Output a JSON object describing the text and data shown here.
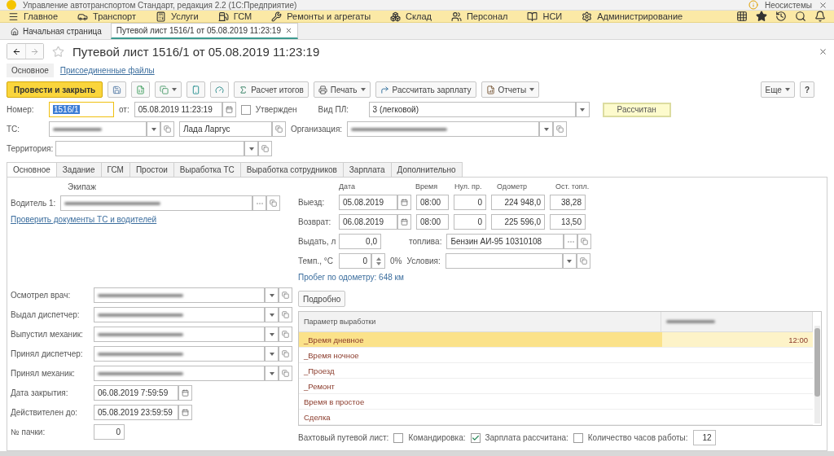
{
  "window": {
    "title": "Управление автотранспортом Стандарт, редакция 2.2  (1С:Предприятие)",
    "user": "Неосистемы"
  },
  "sections": [
    {
      "label": "Главное",
      "kind": "menu"
    },
    {
      "label": "Транспорт",
      "kind": "car"
    },
    {
      "label": "Услуги",
      "kind": "calc"
    },
    {
      "label": "ГСМ",
      "kind": "fuel"
    },
    {
      "label": "Ремонты и агрегаты",
      "kind": "wrench"
    },
    {
      "label": "Склад",
      "kind": "boxes"
    },
    {
      "label": "Персонал",
      "kind": "person"
    },
    {
      "label": "НСИ",
      "kind": "book"
    },
    {
      "label": "Администрирование",
      "kind": "gear"
    }
  ],
  "open_tabs": [
    {
      "label": "Начальная страница",
      "kind": "home",
      "selected": false
    },
    {
      "label": "Путевой лист 1516/1 от 05.08.2019 11:23:19",
      "kind": "doc",
      "selected": true
    }
  ],
  "document": {
    "title": "Путевой лист 1516/1 от 05.08.2019 11:23:19",
    "views": [
      {
        "label": "Основное",
        "selected": true
      },
      {
        "label": "Присоединенные файлы",
        "selected": false
      }
    ]
  },
  "toolbar": {
    "primary": "Провести и закрыть",
    "buttons": [
      {
        "kind": "save"
      },
      {
        "kind": "sheet"
      },
      {
        "kind": "copy",
        "menu": true
      },
      {
        "kind": "phone"
      },
      {
        "kind": "gauge"
      },
      {
        "kind": "sigma",
        "label": "Расчет итогов"
      },
      {
        "kind": "print",
        "label": "Печать",
        "menu": true
      },
      {
        "kind": "arrow",
        "label": "Рассчитать зарплату"
      },
      {
        "kind": "report",
        "label": "Отчеты",
        "menu": true
      }
    ],
    "more": "Еще",
    "help": "?"
  },
  "header": {
    "number_label": "Номер:",
    "number": "1516/1",
    "date_label": "от:",
    "date": "05.08.2019 11:23:19",
    "approved": {
      "label": "Утвержден",
      "checked": false
    },
    "type_label": "Вид ПЛ:",
    "type": "3 (легковой)",
    "status": "Рассчитан",
    "vehicle_label": "ТС:",
    "vehicle_blurred": true,
    "model": "Лада Ларгус",
    "org_label": "Организация:",
    "org_blurred": true,
    "territory_label": "Территория:"
  },
  "form_tabs": [
    {
      "label": "Основное",
      "selected": true
    },
    {
      "label": "Задание",
      "selected": false
    },
    {
      "label": "ГСМ",
      "selected": false
    },
    {
      "label": "Простои",
      "selected": false
    },
    {
      "label": "Выработка ТС",
      "selected": false
    },
    {
      "label": "Выработка сотрудников",
      "selected": false
    },
    {
      "label": "Зарплата",
      "selected": false
    },
    {
      "label": "Дополнительно",
      "selected": false
    }
  ],
  "crew": {
    "heading": "Экипаж",
    "driver_label": "Водитель 1:",
    "driver_blurred": true,
    "link": "Проверить документы ТС и водителей"
  },
  "trip": {
    "columns": [
      "Дата",
      "Время",
      "Нул. пр.",
      "Одометр",
      "Ост. топл."
    ],
    "rows": [
      {
        "label": "Выезд:",
        "date": "05.08.2019",
        "time": "08:00",
        "zero": "0",
        "odometer": "224 948,0",
        "fuel": "38,28"
      },
      {
        "label": "Возврат:",
        "date": "06.08.2019",
        "time": "08:00",
        "zero": "0",
        "odometer": "225 596,0",
        "fuel": "13,50"
      }
    ],
    "issue_label": "Выдать, л",
    "issue": "0,0",
    "fuel_label": "топлива:",
    "fuel_type": "Бензин АИ-95   10310108",
    "temp_label": "Темп., °С",
    "temp": "0",
    "percent": "0%",
    "conditions_label": "Условия:",
    "mileage": "Пробег по одометру: 648 км"
  },
  "staff": [
    {
      "label": "Осмотрел врач:",
      "blurred": true
    },
    {
      "label": "Выдал диспетчер:",
      "blurred": true
    },
    {
      "label": "Выпустил механик:",
      "blurred": true
    },
    {
      "label": "Принял диспетчер:",
      "blurred": true
    },
    {
      "label": "Принял механик:",
      "blurred": true
    }
  ],
  "dates": [
    {
      "label": "Дата закрытия:",
      "value": "06.08.2019  7:59:59"
    },
    {
      "label": "Действителен до:",
      "value": "05.08.2019 23:59:59"
    }
  ],
  "pack": {
    "label": "№ пачки:",
    "value": "0"
  },
  "details_button": "Подробно",
  "table": {
    "columns": [
      "Параметр выработки"
    ],
    "column_2_blurred": true,
    "rows": [
      {
        "name": "_Время дневное",
        "value": "12:00",
        "selected": true
      },
      {
        "name": "_Время ночное",
        "selected": false
      },
      {
        "name": "_Проезд",
        "selected": false
      },
      {
        "name": "_Ремонт",
        "selected": false
      },
      {
        "name": "Время в простое",
        "selected": false
      },
      {
        "name": "Сделка",
        "selected": false
      }
    ]
  },
  "footer": {
    "checks": [
      {
        "label": "Вахтовый путевой лист:",
        "checked": false
      },
      {
        "label": "Командировка:",
        "checked": true
      },
      {
        "label": "Зарплата рассчитана:",
        "checked": false
      }
    ],
    "hours_label": "Количество часов работы:",
    "hours": "12"
  }
}
